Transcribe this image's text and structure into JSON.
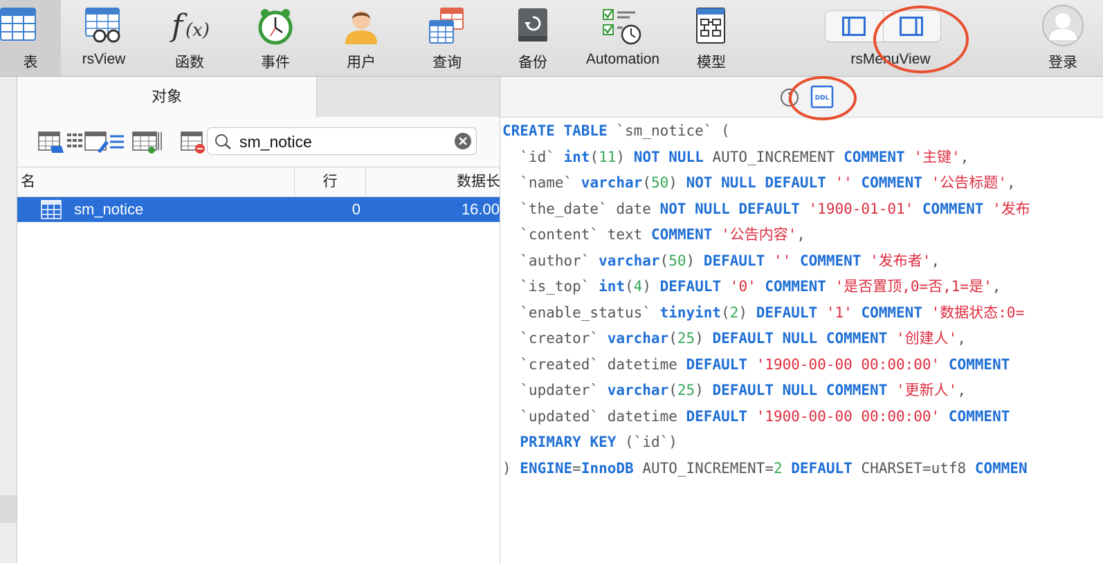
{
  "toolbar": {
    "items": [
      {
        "label": "表",
        "icon": "table-icon",
        "active": true
      },
      {
        "label": "rsView",
        "icon": "view-icon"
      },
      {
        "label": "函数",
        "icon": "function-icon"
      },
      {
        "label": "事件",
        "icon": "alarm-clock-icon"
      },
      {
        "label": "用户",
        "icon": "user-icon"
      },
      {
        "label": "查询",
        "icon": "query-icon"
      },
      {
        "label": "备份",
        "icon": "backup-icon"
      },
      {
        "label": "Automation",
        "icon": "automation-icon"
      },
      {
        "label": "模型",
        "icon": "model-icon"
      }
    ],
    "view_toggle_label": "rsMenuView",
    "login_label": "登录"
  },
  "object_panel": {
    "tab_label": "对象",
    "search_value": "sm_notice",
    "columns": {
      "name": "名",
      "rows": "行",
      "data_length": "数据长"
    },
    "rows": [
      {
        "name": "sm_notice",
        "rows": "0",
        "data_length": "16.00"
      }
    ]
  },
  "ddl": {
    "icon_label": "DDL",
    "lines": [
      [
        [
          "kw",
          "CREATE TABLE "
        ],
        [
          "id",
          "`sm_notice` ("
        ]
      ],
      [
        [
          "id",
          "  `id` "
        ],
        [
          "kw",
          "int"
        ],
        [
          "id",
          "("
        ],
        [
          "num",
          "11"
        ],
        [
          "id",
          ") "
        ],
        [
          "kw",
          "NOT NULL"
        ],
        [
          "id",
          " AUTO_INCREMENT "
        ],
        [
          "kw",
          "COMMENT"
        ],
        [
          "id",
          " "
        ],
        [
          "str",
          "'主键'"
        ],
        [
          "id",
          ","
        ]
      ],
      [
        [
          "id",
          "  `name` "
        ],
        [
          "kw",
          "varchar"
        ],
        [
          "id",
          "("
        ],
        [
          "num",
          "50"
        ],
        [
          "id",
          ") "
        ],
        [
          "kw",
          "NOT NULL DEFAULT"
        ],
        [
          "id",
          " "
        ],
        [
          "str",
          "''"
        ],
        [
          "id",
          " "
        ],
        [
          "kw",
          "COMMENT"
        ],
        [
          "id",
          " "
        ],
        [
          "str",
          "'公告标题'"
        ],
        [
          "id",
          ","
        ]
      ],
      [
        [
          "id",
          "  `the_date` date "
        ],
        [
          "kw",
          "NOT NULL DEFAULT"
        ],
        [
          "id",
          " "
        ],
        [
          "str",
          "'1900-01-01'"
        ],
        [
          "id",
          " "
        ],
        [
          "kw",
          "COMMENT"
        ],
        [
          "id",
          " "
        ],
        [
          "str",
          "'发布"
        ]
      ],
      [
        [
          "id",
          "  `content` text "
        ],
        [
          "kw",
          "COMMENT"
        ],
        [
          "id",
          " "
        ],
        [
          "str",
          "'公告内容'"
        ],
        [
          "id",
          ","
        ]
      ],
      [
        [
          "id",
          "  `author` "
        ],
        [
          "kw",
          "varchar"
        ],
        [
          "id",
          "("
        ],
        [
          "num",
          "50"
        ],
        [
          "id",
          ") "
        ],
        [
          "kw",
          "DEFAULT"
        ],
        [
          "id",
          " "
        ],
        [
          "str",
          "''"
        ],
        [
          "id",
          " "
        ],
        [
          "kw",
          "COMMENT"
        ],
        [
          "id",
          " "
        ],
        [
          "str",
          "'发布者'"
        ],
        [
          "id",
          ","
        ]
      ],
      [
        [
          "id",
          "  `is_top` "
        ],
        [
          "kw",
          "int"
        ],
        [
          "id",
          "("
        ],
        [
          "num",
          "4"
        ],
        [
          "id",
          ") "
        ],
        [
          "kw",
          "DEFAULT"
        ],
        [
          "id",
          " "
        ],
        [
          "str",
          "'0'"
        ],
        [
          "id",
          " "
        ],
        [
          "kw",
          "COMMENT"
        ],
        [
          "id",
          " "
        ],
        [
          "str",
          "'是否置顶,0=否,1=是'"
        ],
        [
          "id",
          ","
        ]
      ],
      [
        [
          "id",
          "  `enable_status` "
        ],
        [
          "kw",
          "tinyint"
        ],
        [
          "id",
          "("
        ],
        [
          "num",
          "2"
        ],
        [
          "id",
          ") "
        ],
        [
          "kw",
          "DEFAULT"
        ],
        [
          "id",
          " "
        ],
        [
          "str",
          "'1'"
        ],
        [
          "id",
          " "
        ],
        [
          "kw",
          "COMMENT"
        ],
        [
          "id",
          " "
        ],
        [
          "str",
          "'数据状态:0="
        ]
      ],
      [
        [
          "id",
          "  `creator` "
        ],
        [
          "kw",
          "varchar"
        ],
        [
          "id",
          "("
        ],
        [
          "num",
          "25"
        ],
        [
          "id",
          ") "
        ],
        [
          "kw",
          "DEFAULT NULL COMMENT"
        ],
        [
          "id",
          " "
        ],
        [
          "str",
          "'创建人'"
        ],
        [
          "id",
          ","
        ]
      ],
      [
        [
          "id",
          "  `created` datetime "
        ],
        [
          "kw",
          "DEFAULT"
        ],
        [
          "id",
          " "
        ],
        [
          "str",
          "'1900-00-00 00:00:00'"
        ],
        [
          "id",
          " "
        ],
        [
          "kw",
          "COMMENT"
        ]
      ],
      [
        [
          "id",
          "  `updater` "
        ],
        [
          "kw",
          "varchar"
        ],
        [
          "id",
          "("
        ],
        [
          "num",
          "25"
        ],
        [
          "id",
          ") "
        ],
        [
          "kw",
          "DEFAULT NULL COMMENT"
        ],
        [
          "id",
          " "
        ],
        [
          "str",
          "'更新人'"
        ],
        [
          "id",
          ","
        ]
      ],
      [
        [
          "id",
          "  `updated` datetime "
        ],
        [
          "kw",
          "DEFAULT"
        ],
        [
          "id",
          " "
        ],
        [
          "str",
          "'1900-00-00 00:00:00'"
        ],
        [
          "id",
          " "
        ],
        [
          "kw",
          "COMMENT"
        ]
      ],
      [
        [
          "id",
          "  "
        ],
        [
          "kw",
          "PRIMARY KEY"
        ],
        [
          "id",
          " (`id`)"
        ]
      ],
      [
        [
          "id",
          ") "
        ],
        [
          "kw",
          "ENGINE"
        ],
        [
          "id",
          "="
        ],
        [
          "kw",
          "InnoDB"
        ],
        [
          "id",
          " AUTO_INCREMENT="
        ],
        [
          "num",
          "2"
        ],
        [
          "id",
          " "
        ],
        [
          "kw",
          "DEFAULT"
        ],
        [
          "id",
          " CHARSET=utf8 "
        ],
        [
          "kw",
          "COMMEN"
        ]
      ]
    ]
  },
  "colors": {
    "selection": "#2a6fd8",
    "keyword": "#1f6fd6",
    "string": "#dd2e3f",
    "number": "#37a858",
    "annotation": "#e8502e"
  }
}
